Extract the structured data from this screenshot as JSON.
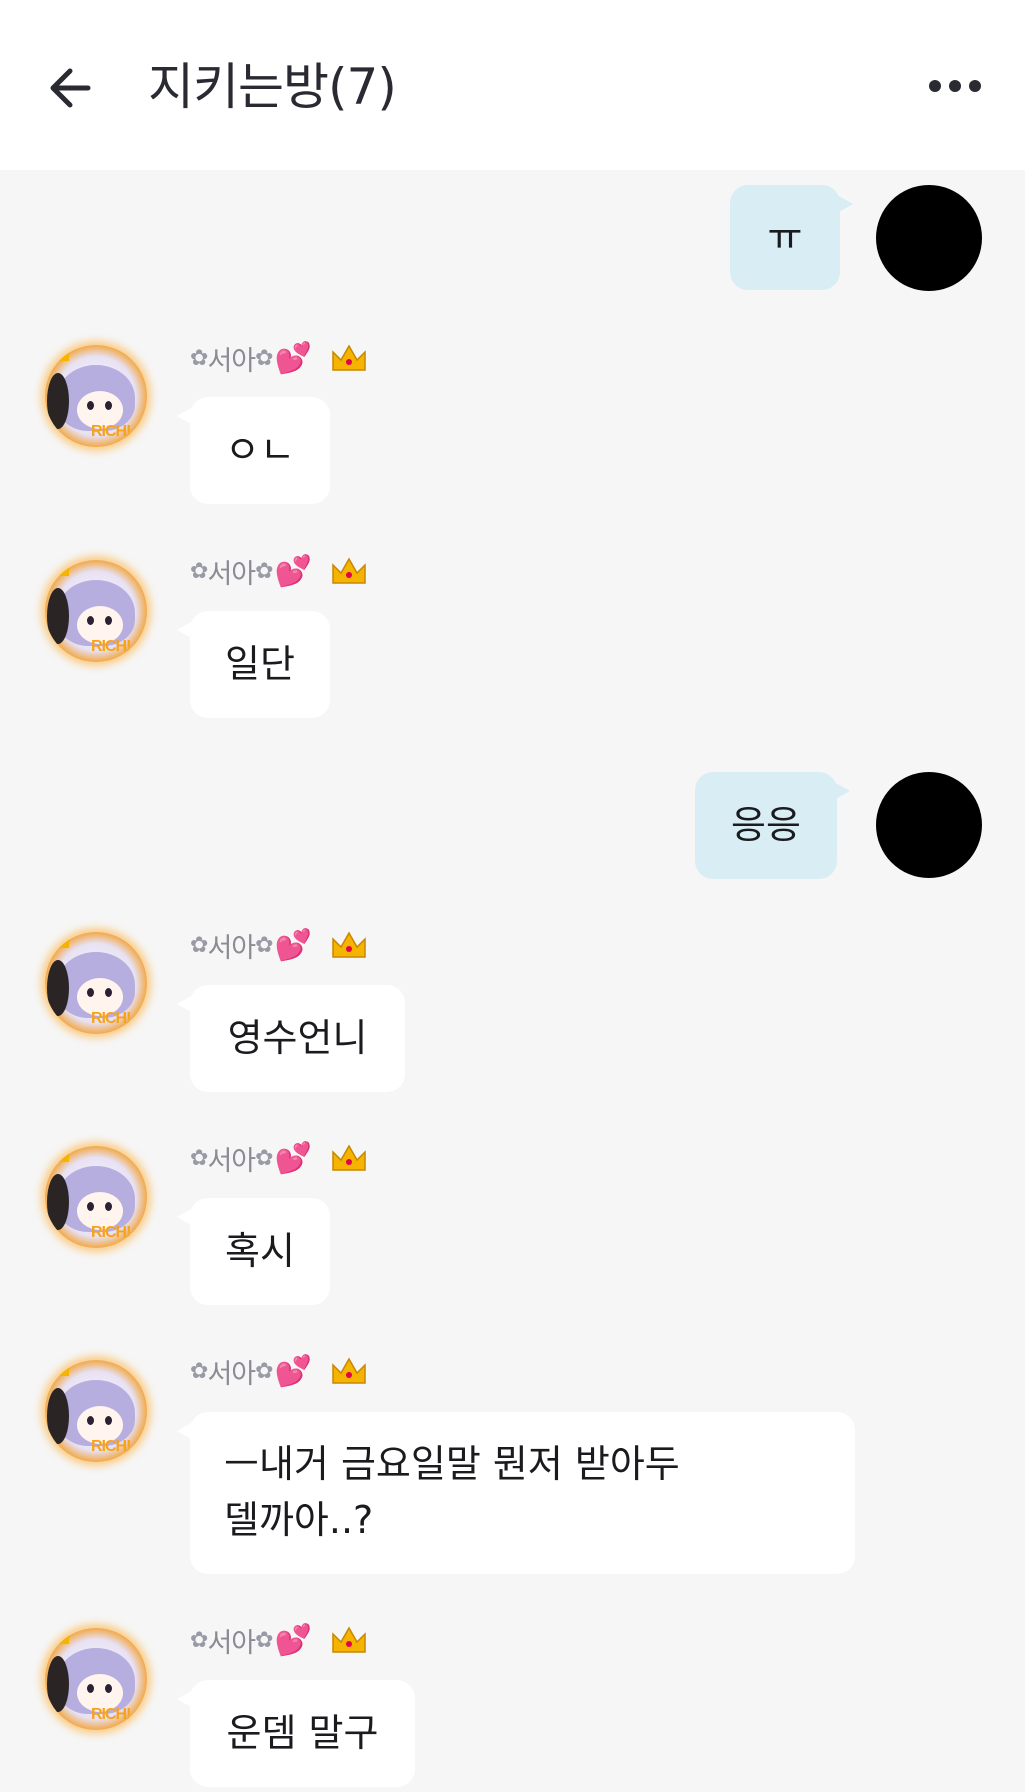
{
  "header": {
    "title": "지키는방(7)"
  },
  "sender_name": "서아",
  "sender_flower": "✿",
  "sender_hearts": "💕",
  "colors": {
    "background": "#f6f6f6",
    "outgoing_bubble": "#d8edf4",
    "incoming_bubble": "#ffffff",
    "header": "#ffffff"
  },
  "messages": [
    {
      "from": "me",
      "text": "ㅠ"
    },
    {
      "from": "other",
      "text": "ㅇㄴ"
    },
    {
      "from": "other",
      "text": "일단"
    },
    {
      "from": "me",
      "text": "응응"
    },
    {
      "from": "other",
      "text": "영수언니"
    },
    {
      "from": "other",
      "text": "혹시"
    },
    {
      "from": "other",
      "lines": [
        "ㅡ내거 금요일말 뭔저 받아두",
        "델까아..?"
      ]
    },
    {
      "from": "other",
      "text": "운뎀 말구"
    }
  ],
  "avatar_badge": "RICH!"
}
